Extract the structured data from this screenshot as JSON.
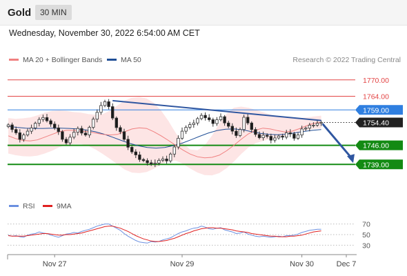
{
  "header": {
    "symbol": "Gold",
    "timeframe": "30 MIN",
    "datetime": "Wednesday, November 30, 2022 6:54:00 AM CET"
  },
  "legend": {
    "ma20": "MA 20 + Bollinger Bands",
    "ma50": "MA 50",
    "credit": "Research © 2022 Trading Central",
    "rsi": "RSI",
    "rsi_ma": "9MA"
  },
  "colors": {
    "ma20": "#f08080",
    "ma50": "#1f4e96",
    "band": "#fde0e0",
    "support": "#138a13",
    "resistance_blue": "#2f7fe0",
    "resistance_red": "#e34444",
    "trend": "#2f56a0",
    "candle_up": "#333333",
    "candle_down": "#1a1a1a",
    "rsi": "#6a8fe0",
    "rsi_ma": "#e02020"
  },
  "chart_data": [
    {
      "type": "candlestick",
      "x_labels": [
        "Nov 27",
        "Nov 29",
        "Nov 30",
        "Dec 7"
      ],
      "ylim": [
        1733,
        1774
      ],
      "levels": [
        {
          "label": "1770.00",
          "value": 1770.0,
          "kind": "resistance"
        },
        {
          "label": "1764.00",
          "value": 1764.0,
          "kind": "resistance"
        },
        {
          "label": "1759.00",
          "value": 1759.0,
          "kind": "pivot"
        },
        {
          "label": "1754.40",
          "value": 1754.4,
          "kind": "last"
        },
        {
          "label": "1746.00",
          "value": 1746.0,
          "kind": "support"
        },
        {
          "label": "1739.00",
          "value": 1739.0,
          "kind": "support"
        }
      ],
      "closes": [
        1753.5,
        1751.8,
        1750.6,
        1748.2,
        1749.8,
        1751.2,
        1752.4,
        1754.1,
        1755.5,
        1756.2,
        1755.0,
        1753.8,
        1752.4,
        1751.0,
        1748.2,
        1746.9,
        1749.0,
        1750.8,
        1752.2,
        1750.5,
        1749.8,
        1752.6,
        1755.6,
        1758.1,
        1760.6,
        1762.0,
        1760.2,
        1756.0,
        1752.5,
        1751.0,
        1748.2,
        1745.3,
        1743.6,
        1742.5,
        1740.8,
        1740.4,
        1739.6,
        1739.2,
        1739.5,
        1740.5,
        1741.0,
        1740.3,
        1742.8,
        1745.4,
        1748.6,
        1751.2,
        1752.6,
        1753.6,
        1754.2,
        1755.8,
        1757.0,
        1756.1,
        1755.4,
        1754.0,
        1755.4,
        1756.5,
        1754.2,
        1753.0,
        1751.2,
        1749.6,
        1751.8,
        1756.3,
        1754.2,
        1751.8,
        1750.0,
        1748.8,
        1749.7,
        1749.3,
        1747.9,
        1748.7,
        1749.4,
        1749.0,
        1750.6,
        1750.2,
        1748.6,
        1749.8,
        1752.0,
        1752.3,
        1753.4,
        1753.4,
        1754.1,
        1754.4
      ],
      "ma20": [
        1749.5,
        1748.5,
        1747.8,
        1747.6,
        1748.0,
        1749.0,
        1750.0,
        1751.0,
        1751.5,
        1751.5,
        1751.2,
        1751.0,
        1750.5,
        1750.0,
        1749.8,
        1750.0,
        1751.0,
        1752.0,
        1752.4,
        1752.2,
        1751.0,
        1749.5,
        1747.8,
        1746.0,
        1744.3,
        1742.8,
        1741.8,
        1741.4,
        1741.6,
        1742.4,
        1744.0,
        1746.0,
        1748.2,
        1750.2,
        1751.6,
        1752.3,
        1752.0,
        1751.4,
        1750.9,
        1751.2,
        1752.1,
        1753.2,
        1754.1,
        1754.4
      ],
      "ma50": [
        1753.0,
        1752.6,
        1752.3,
        1752.2,
        1752.2,
        1752.3,
        1752.3,
        1752.2,
        1752.0,
        1751.6,
        1751.0,
        1750.1,
        1749.0,
        1747.8,
        1746.7,
        1745.8,
        1745.2,
        1745.0,
        1745.2,
        1745.9,
        1746.8,
        1748.0,
        1749.3,
        1750.5,
        1751.4,
        1751.9,
        1752.0,
        1751.7,
        1751.0,
        1750.4,
        1750.0,
        1749.9,
        1750.1,
        1750.6,
        1751.1,
        1751.5,
        1751.8
      ],
      "bb_upper": [
        1756.0,
        1755.7,
        1755.9,
        1756.2,
        1757.0,
        1758.0,
        1758.6,
        1758.8,
        1758.6,
        1758.2,
        1758.0,
        1757.5,
        1757.2,
        1757.5,
        1758.8,
        1760.6,
        1762.4,
        1763.5,
        1763.8,
        1763.2,
        1761.6,
        1758.8,
        1755.0,
        1750.6,
        1746.8,
        1744.5,
        1744.2,
        1746.0,
        1749.6,
        1754.0,
        1757.6,
        1759.8,
        1760.2,
        1759.8,
        1759.0,
        1758.2,
        1757.3,
        1756.6,
        1756.2,
        1756.0,
        1756.0,
        1756.2,
        1756.6,
        1756.9
      ],
      "bb_lower": [
        1743.0,
        1742.4,
        1742.0,
        1741.9,
        1742.2,
        1743.0,
        1744.0,
        1745.3,
        1746.2,
        1746.5,
        1746.5,
        1745.8,
        1744.5,
        1742.8,
        1741.0,
        1739.0,
        1737.1,
        1736.0,
        1735.8,
        1736.2,
        1737.4,
        1739.0,
        1740.2,
        1740.4,
        1739.2,
        1737.5,
        1736.0,
        1735.1,
        1735.0,
        1735.8,
        1737.6,
        1740.0,
        1742.8,
        1745.2,
        1746.8,
        1747.6,
        1748.3,
        1748.8,
        1749.5,
        1750.2,
        1751.0,
        1751.6,
        1752.0,
        1752.2
      ],
      "trendline": [
        {
          "i": 27,
          "price": 1762.4
        },
        {
          "i": 81,
          "price": 1755.1
        }
      ],
      "projection": {
        "from_price": 1754.4,
        "to_price": 1739.0
      },
      "markers": [
        "MA 20",
        "MA 50"
      ]
    },
    {
      "type": "line",
      "name_series": [
        "RSI",
        "9MA"
      ],
      "ylim": [
        15,
        85
      ],
      "levels": [
        70,
        50,
        30
      ],
      "rsi": [
        49,
        47,
        48,
        46,
        45,
        49,
        51,
        52,
        55,
        53,
        52,
        49,
        47,
        45,
        48,
        51,
        52,
        54,
        53,
        56,
        58,
        60,
        63,
        66,
        68,
        70,
        70,
        66,
        62,
        58,
        52,
        47,
        43,
        39,
        36,
        35,
        34,
        37,
        36,
        37,
        40,
        42,
        44,
        48,
        52,
        55,
        57,
        60,
        62,
        63,
        66,
        64,
        61,
        60,
        62,
        63,
        59,
        57,
        55,
        52,
        53,
        55,
        51,
        49,
        47,
        46,
        47,
        46,
        45,
        46,
        47,
        46,
        48,
        48,
        49,
        51,
        54,
        56,
        58,
        59,
        60,
        60
      ],
      "rsi_ma": [
        48,
        47,
        47,
        47,
        47,
        48,
        49,
        50,
        51,
        52,
        52,
        51,
        50,
        49,
        49,
        50,
        50,
        51,
        52,
        53,
        55,
        57,
        59,
        61,
        63,
        65,
        66,
        66,
        64,
        62,
        59,
        56,
        52,
        48,
        45,
        42,
        40,
        38,
        37,
        37,
        38,
        39,
        41,
        43,
        46,
        49,
        52,
        54,
        57,
        59,
        61,
        62,
        63,
        63,
        62,
        62,
        61,
        60,
        59,
        57,
        56,
        55,
        54,
        52,
        51,
        50,
        49,
        48,
        47,
        47,
        46,
        46,
        46,
        47,
        47,
        48,
        49,
        51,
        53,
        55,
        56,
        57
      ]
    }
  ]
}
